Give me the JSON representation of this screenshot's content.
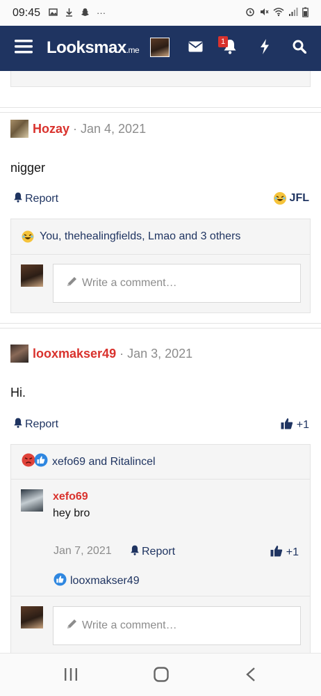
{
  "status_bar": {
    "time": "09:45",
    "more": "···"
  },
  "nav": {
    "logo_main": "Looksmax",
    "logo_suffix": ".me",
    "notification_count": "1"
  },
  "posts": [
    {
      "username": "Hozay",
      "date": "· Jan 4, 2021",
      "body": "nigger",
      "report_label": "Report",
      "reaction_label": "JFL",
      "reactions_summary": "You, thehealingfields, Lmao and 3 others",
      "comment_placeholder": "Write a comment…"
    },
    {
      "username": "looxmakser49",
      "date": "· Jan 3, 2021",
      "body": "Hi.",
      "report_label": "Report",
      "reaction_label": "+1",
      "reactions_summary": "xefo69 and Ritalincel",
      "reply": {
        "username": "xefo69",
        "body": "hey bro",
        "date": "Jan 7, 2021",
        "report_label": "Report",
        "reaction_label": "+1",
        "reactions_summary": "looxmakser49"
      },
      "comment_placeholder": "Write a comment…"
    }
  ],
  "colors": {
    "nav_bg": "#1f3461",
    "username": "#d9322d",
    "link": "#1f3461"
  }
}
